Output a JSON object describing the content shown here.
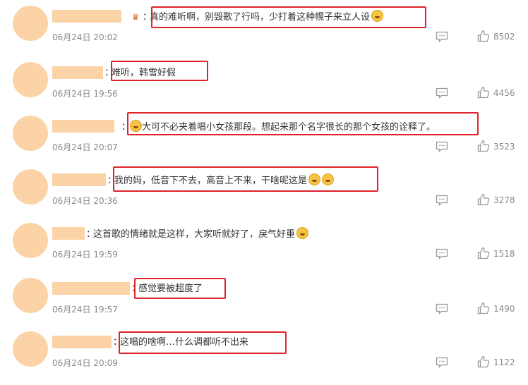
{
  "comments": [
    {
      "time": "06月24日 20:02",
      "text": "真的难听啊，别毁歌了行吗，少打着这种幌子来立人设",
      "likes": "8502",
      "emoji_prefix": false,
      "emoji_suffix": 1,
      "crown": true
    },
    {
      "time": "06月24日 19:56",
      "text": "难听，韩雪好假",
      "likes": "4456",
      "emoji_prefix": false,
      "emoji_suffix": 0,
      "crown": false
    },
    {
      "time": "06月24日 20:07",
      "text": "大可不必夹着唱小女孩那段。想起来那个名字很长的那个女孩的诠释了。",
      "likes": "3523",
      "emoji_prefix": true,
      "emoji_suffix": 0,
      "crown": false
    },
    {
      "time": "06月24日 20:36",
      "text": "我的妈，低音下不去，高音上不来，干啥呢这是",
      "likes": "3278",
      "emoji_prefix": false,
      "emoji_suffix": 2,
      "crown": false
    },
    {
      "time": "06月24日 19:59",
      "text": "这首歌的情绪就是这样，大家听就好了，戾气好重",
      "likes": "1518",
      "emoji_prefix": false,
      "emoji_suffix": 1,
      "crown": false
    },
    {
      "time": "06月24日 19:57",
      "text": "感觉要被超度了",
      "likes": "1490",
      "emoji_prefix": false,
      "emoji_suffix": 0,
      "crown": false
    },
    {
      "time": "06月24日 20:09",
      "text": "这唱的啥啊…什么调都听不出来",
      "likes": "1122",
      "emoji_prefix": false,
      "emoji_suffix": 0,
      "crown": false
    }
  ],
  "colon": "：",
  "icons": {
    "reply": "comment-icon",
    "like": "thumbs-up-icon",
    "crown": "crown-icon",
    "emoji": "emoji-icon"
  },
  "colors": {
    "avatar": "#fbd3a6",
    "highlight_box": "#e0222a",
    "meta_text": "#888888"
  }
}
